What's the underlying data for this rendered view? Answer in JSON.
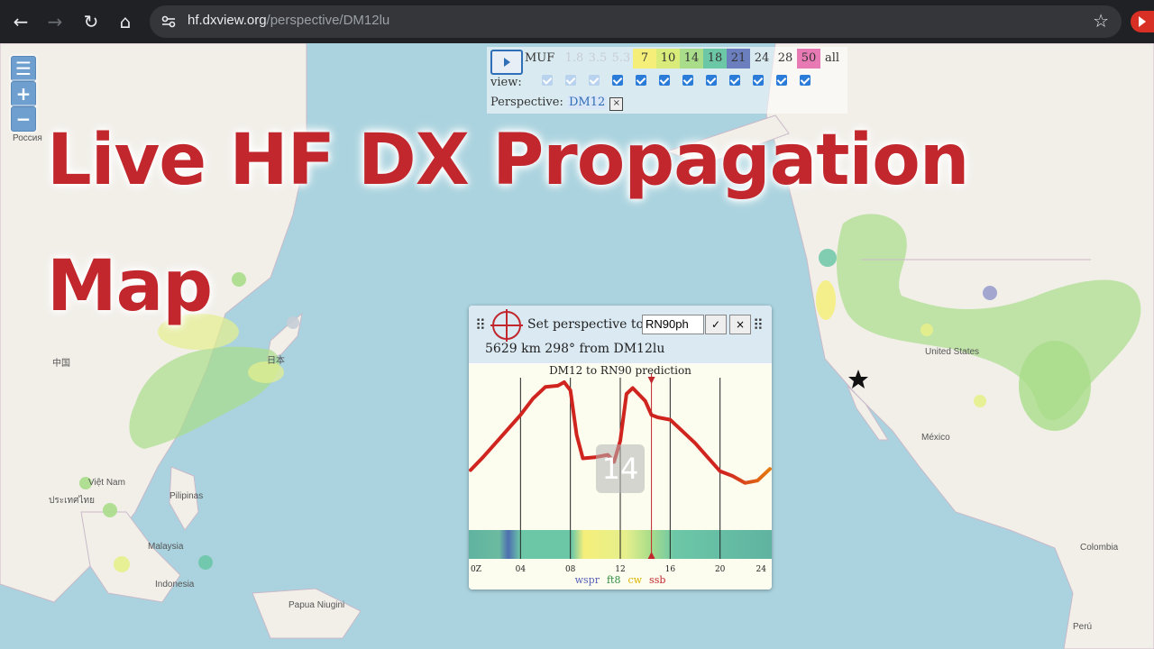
{
  "browser": {
    "url_host": "hf.dxview.org",
    "url_path": "/perspective/DM12lu"
  },
  "headline": {
    "line1": "Live HF DX Propagation",
    "line2": "Map"
  },
  "band_panel": {
    "muf_label": "MUF",
    "bands": [
      {
        "label": "1.8",
        "color": "",
        "dim": true
      },
      {
        "label": "3.5",
        "color": "",
        "dim": true
      },
      {
        "label": "5.3",
        "color": "",
        "dim": true
      },
      {
        "label": "7",
        "color": "#f5ef7a",
        "dim": false
      },
      {
        "label": "10",
        "color": "#d9ec7a",
        "dim": false
      },
      {
        "label": "14",
        "color": "#a9dd8a",
        "dim": false
      },
      {
        "label": "18",
        "color": "#6cc7a7",
        "dim": false
      },
      {
        "label": "21",
        "color": "#6b7fbf",
        "dim": false
      },
      {
        "label": "24",
        "color": "",
        "dim": false
      },
      {
        "label": "28",
        "color": "",
        "dim": false
      },
      {
        "label": "50",
        "color": "#e77ab4",
        "dim": false
      },
      {
        "label": "all",
        "color": "",
        "dim": false
      }
    ],
    "view_label": "view:",
    "perspective_label": "Perspective:",
    "perspective_value": "DM12",
    "perspective_clear": "×"
  },
  "map_labels": {
    "russia": "Россия",
    "china": "中国",
    "japan": "日本",
    "thailand": "ประเทศไทย",
    "vietnam": "Việt Nam",
    "philippines": "Pilipinas",
    "malaysia": "Malaysia",
    "indonesia": "Indonesia",
    "png": "Papua Niugini",
    "usa": "United States",
    "mexico": "México",
    "colombia": "Colombia",
    "peru": "Perú"
  },
  "zoom": {
    "menu": "☰",
    "in": "+",
    "out": "−"
  },
  "popup": {
    "set_label": "Set perspective to",
    "input_value": "RN90ph",
    "ok": "✓",
    "close": "×",
    "distance": "5629 km 298° from DM12lu",
    "chart_title": "DM12 to RN90 prediction",
    "big_band": "14",
    "modes": [
      {
        "label": "wspr",
        "color": "#5560b8"
      },
      {
        "label": "ft8",
        "color": "#2e8b3e"
      },
      {
        "label": "cw",
        "color": "#d8b400"
      },
      {
        "label": "ssb",
        "color": "#c1272d"
      }
    ]
  },
  "chart_data": {
    "type": "line",
    "title": "DM12 to RN90 prediction",
    "xlabel": "",
    "ylabel": "",
    "x_ticks": [
      "0Z",
      "04",
      "08",
      "12",
      "16",
      "20",
      "24"
    ],
    "xlim": [
      0,
      24
    ],
    "ylim": [
      0,
      1
    ],
    "current_time_marker": 14.5,
    "x": [
      0,
      1,
      2,
      3,
      4,
      5,
      6,
      7,
      7.5,
      8,
      8.5,
      9,
      10,
      11,
      11.5,
      12,
      12.5,
      13,
      14,
      14.5,
      15,
      16,
      17,
      18,
      19,
      20,
      21,
      22,
      23,
      24
    ],
    "series": [
      {
        "values": [
          0.25,
          0.36,
          0.48,
          0.6,
          0.72,
          0.86,
          0.96,
          0.97,
          1.0,
          0.93,
          0.55,
          0.35,
          0.36,
          0.38,
          0.32,
          0.5,
          0.9,
          0.95,
          0.84,
          0.72,
          0.7,
          0.68,
          0.58,
          0.48,
          0.36,
          0.24,
          0.2,
          0.14,
          0.16,
          0.26
        ]
      }
    ]
  }
}
